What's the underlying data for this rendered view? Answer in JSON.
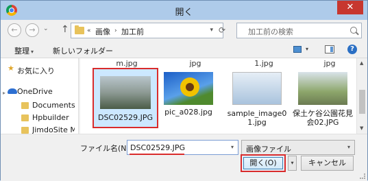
{
  "window": {
    "title": "開く",
    "close_label": "✕"
  },
  "nav": {
    "back_label": "←",
    "forward_label": "→",
    "history_label": "⌄",
    "up_label": "↑",
    "chevrons": "«",
    "breadcrumbs": [
      "画像",
      "加工前"
    ],
    "separator": "›",
    "address_dropdown": "▾",
    "refresh_label": "⟳",
    "search_placeholder": "加工前の検索"
  },
  "toolbar": {
    "organize_label": "整理",
    "organize_drop": "▾",
    "new_folder_label": "新しいフォルダー",
    "view_drop": "▾",
    "help_label": "?"
  },
  "sidebar": {
    "items": [
      {
        "label": "お気に入り",
        "icon": "star-icon"
      },
      {
        "label": "OneDrive",
        "icon": "cloud-icon"
      },
      {
        "label": "Documents",
        "icon": "folder-icon"
      },
      {
        "label": "Hpbuilder",
        "icon": "folder-icon"
      },
      {
        "label": "JimdoSite M",
        "icon": "folder-icon"
      }
    ],
    "expander": "▸"
  },
  "files": {
    "partial_captions": [
      "m.jpg",
      "jpg",
      "1.jpg",
      "jpg"
    ],
    "items": [
      {
        "name": "DSC02529.JPG",
        "selected": true,
        "thumb_color": "#7d8a8f"
      },
      {
        "name": "pic_a028.jpg",
        "selected": false,
        "thumb_color": "#2a6ed4"
      },
      {
        "name": "sample_image01.jpg",
        "name_line1": "sample_image0",
        "name_line2": "1.jpg",
        "selected": false,
        "thumb_color": "#b8d0e8"
      },
      {
        "name": "保土ケ谷公園花見会02.JPG",
        "name_line1": "保土ケ谷公園花見",
        "name_line2": "会02.JPG",
        "selected": false,
        "thumb_color": "#7a9a5a"
      }
    ]
  },
  "scrollbar": {
    "up": "▲",
    "down": "▼"
  },
  "bottom": {
    "filename_label": "ファイル名(N):",
    "filename_value": "DSC02529.JPG",
    "filename_drop": "▾",
    "filetype_value": "画像ファイル",
    "filetype_drop": "▾",
    "open_label": "開く(O)",
    "open_split": "▾",
    "cancel_label": "キャンセル"
  },
  "colors": {
    "highlight_red": "#d92b2b",
    "selection_blue": "#cce8ff",
    "title_bar": "#aecbea"
  }
}
